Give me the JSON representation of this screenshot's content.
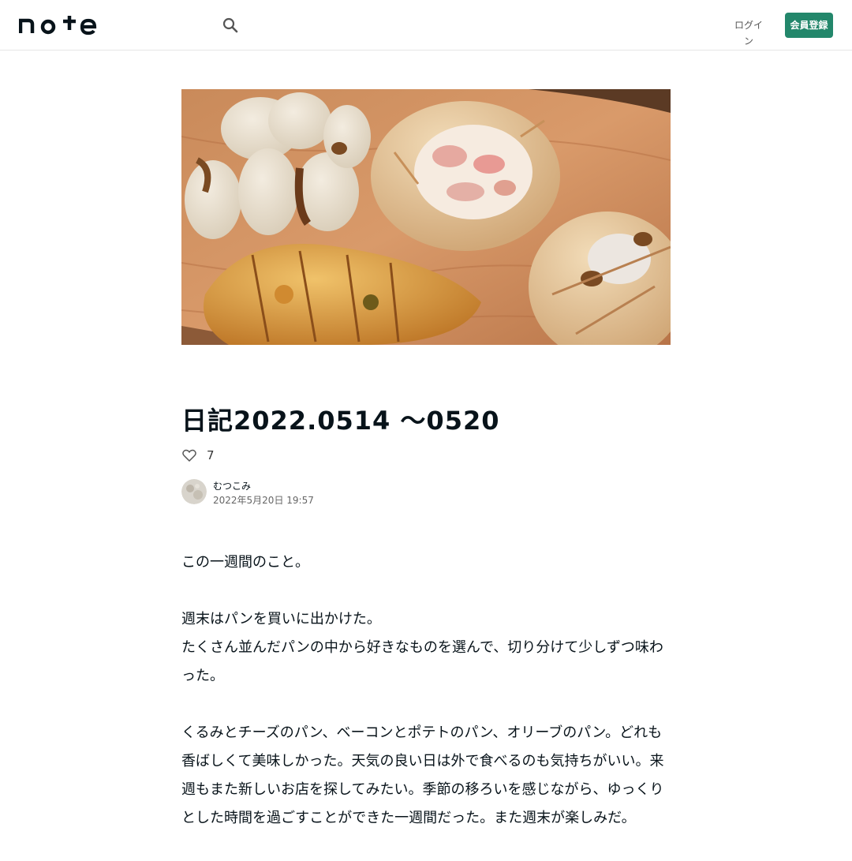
{
  "header": {
    "logo_text": "note",
    "login_label": "ログイン",
    "signup_label": "会員登録"
  },
  "article": {
    "title": "日記2022.0514 〜0520",
    "like_count": "7",
    "author_name": "むつこみ",
    "date": "2022年5月20日 19:57",
    "paragraphs": [
      "この一週間のこと。",
      "週末はパンを買いに出かけた。\nたくさん並んだパンの中から好きなものを選んで、切り分けて少しずつ味わった。",
      "くるみとチーズのパン、ベーコンとポテトのパン、オリーブのパン。どれも香ばしくて美味しかった。天気の良い日は外で食べるのも気持ちがいい。来週もまた新しいお店を探してみたい。季節の移ろいを感じながら、ゆっくりとした時間を過ごすことができた一週間だった。また週末が楽しみだ。"
    ]
  },
  "icons": {
    "search": "search-icon",
    "like": "heart-icon"
  },
  "colors": {
    "brand": "#23876b",
    "text": "#08131a"
  }
}
